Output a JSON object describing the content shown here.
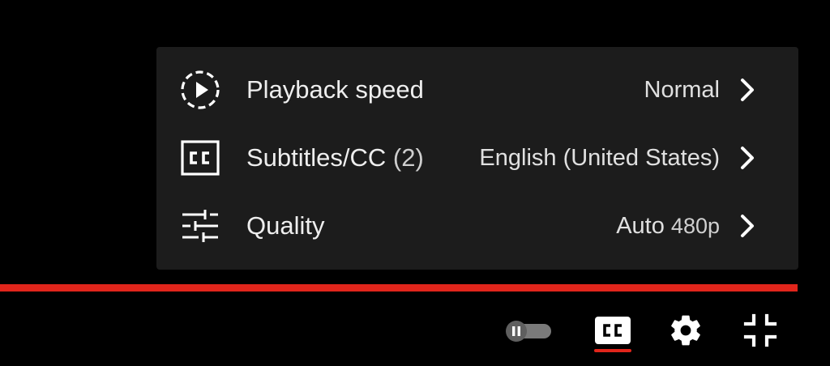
{
  "settings_menu": {
    "items": [
      {
        "label": "Playback speed",
        "count": "",
        "value": "Normal",
        "value_sub": "",
        "icon": "playback-speed-icon"
      },
      {
        "label": "Subtitles/CC",
        "count": "(2)",
        "value": "English (United States)",
        "value_sub": "",
        "icon": "subtitles-icon"
      },
      {
        "label": "Quality",
        "count": "",
        "value": "Auto",
        "value_sub": "480p",
        "icon": "quality-sliders-icon"
      }
    ]
  },
  "progress": {
    "fraction": 1.0,
    "color": "#e1251b"
  },
  "controls": {
    "autoplay_toggle": "off",
    "subtitles_active": true,
    "icons": [
      "autoplay-toggle-icon",
      "subtitles-icon",
      "gear-icon",
      "exit-fullscreen-icon"
    ]
  },
  "colors": {
    "accent": "#e1251b",
    "menu_bg": "#1c1c1c",
    "text": "#eeeeee"
  }
}
